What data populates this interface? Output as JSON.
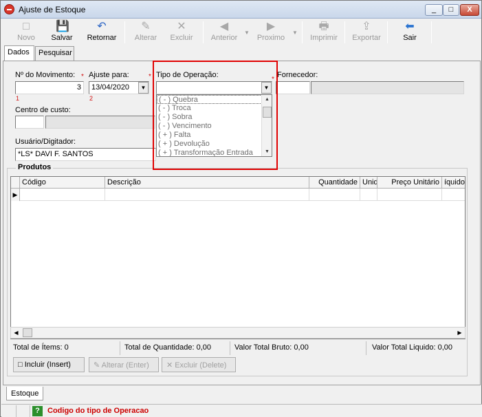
{
  "window": {
    "title": "Ajuste de Estoque",
    "minimize": "_",
    "maximize": "□",
    "close": "X"
  },
  "toolbar": {
    "novo": "Novo",
    "salvar": "Salvar",
    "retornar": "Retornar",
    "alterar": "Alterar",
    "excluir": "Excluir",
    "anterior": "Anterior",
    "proximo": "Proximo",
    "imprimir": "Imprimir",
    "exportar": "Exportar",
    "sair": "Sair"
  },
  "icons": {
    "novo": "□",
    "salvar": "💾",
    "retornar": "↶",
    "alterar": "✎",
    "excluir": "✕",
    "anterior": "◀",
    "proximo": "▶",
    "imprimir": "🖶",
    "exportar": "⇪",
    "sair": "⬅",
    "dropdown": "▼",
    "scroll_up": "▲",
    "scroll_down": "▼",
    "scroll_left": "◀",
    "scroll_right": "▶",
    "row_indicator": "▶",
    "help": "?"
  },
  "tabs": {
    "dados": "Dados",
    "pesquisar": "Pesquisar"
  },
  "form": {
    "movimento_label": "Nº do Movimento:",
    "movimento_value": "3",
    "movimento_idx": "1",
    "ajuste_label": "Ajuste para:",
    "ajuste_value": "13/04/2020",
    "ajuste_idx": "2",
    "tipo_label": "Tipo de Operação:",
    "tipo_value": "",
    "fornecedor_label": "Fornecedor:",
    "centro_label": "Centro de custo:",
    "usuario_label": "Usuário/Digitador:",
    "usuario_value": "*LS* DAVI F. SANTOS",
    "req_mark": "*"
  },
  "dropdown": {
    "options": [
      "( - ) Quebra",
      "( - ) Troca",
      "( - ) Sobra",
      "( - ) Vencimento",
      "( + ) Falta",
      "( + ) Devolução",
      "( + ) Transformação Entrada"
    ]
  },
  "produtos": {
    "legend": "Produtos",
    "columns": [
      "Código",
      "Descrição",
      "Quantidade",
      "Unid",
      "Preço Unitário",
      "íquido"
    ]
  },
  "totals": {
    "itens": "Total de Ítems: 0",
    "quantidade": "Total de Quantidade: 0,00",
    "bruto": "Valor Total Bruto: 0,00",
    "liquido": "Valor Total Liquido: 0,00"
  },
  "actions": {
    "incluir": "Incluir (Insert)",
    "alterar": "Alterar (Enter)",
    "excluir": "Excluir (Delete)"
  },
  "bottom_tab": "Estoque",
  "status": {
    "message": "Codigo do tipo de Operacao"
  },
  "colors": {
    "required": "#d01010",
    "highlight": "#e00000",
    "status_text": "#cc0000"
  }
}
